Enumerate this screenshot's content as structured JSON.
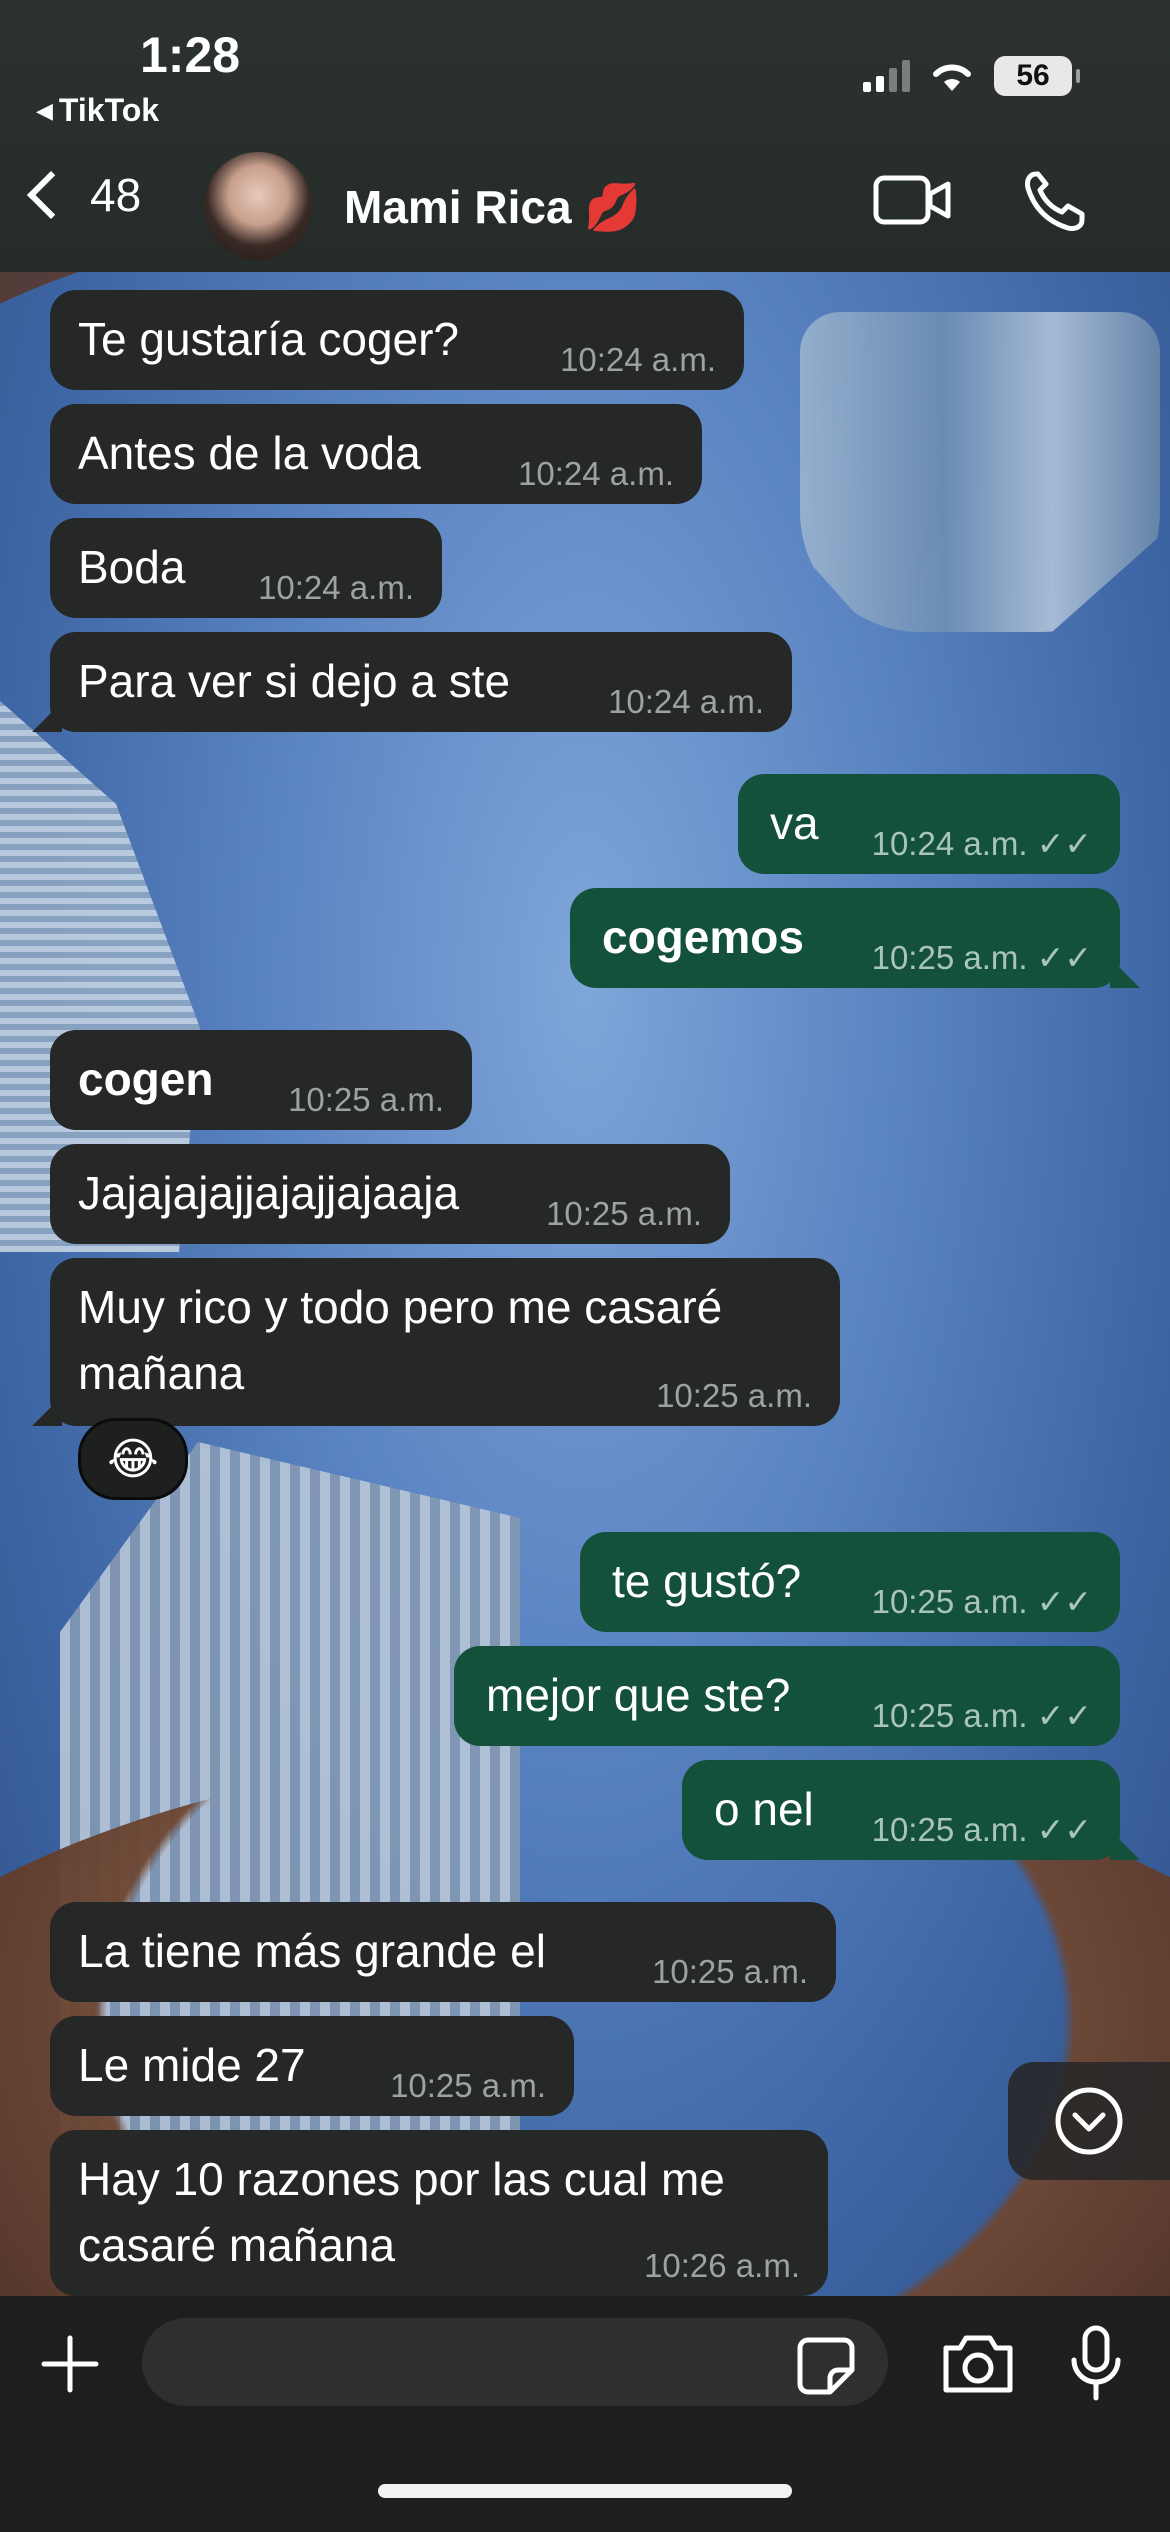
{
  "status_bar": {
    "time": "1:28",
    "back_app": "TikTok",
    "battery": "56",
    "icons": [
      "signal-icon",
      "wifi-icon",
      "battery-icon"
    ]
  },
  "header": {
    "back_count": "48",
    "contact_name": "Mami Rica 💋",
    "icons": [
      "back-chevron-icon",
      "video-call-icon",
      "phone-call-icon"
    ]
  },
  "messages": [
    {
      "dir": "in",
      "text": "Te gustaría coger?",
      "time": "10:24 a.m."
    },
    {
      "dir": "in",
      "text": "Antes de la voda",
      "time": "10:24 a.m."
    },
    {
      "dir": "in",
      "text": "Boda",
      "time": "10:24 a.m."
    },
    {
      "dir": "in",
      "text": "Para ver si dejo a ste",
      "time": "10:24 a.m."
    },
    {
      "dir": "out",
      "text": "va",
      "time": "10:24 a.m. ✓✓"
    },
    {
      "dir": "out",
      "text": "cogemos",
      "time": "10:25 a.m. ✓✓",
      "bold": true
    },
    {
      "dir": "in",
      "text": "cogen",
      "time": "10:25 a.m.",
      "bold": true
    },
    {
      "dir": "in",
      "text": "Jajajajajjajajjajaaja",
      "time": "10:25 a.m."
    },
    {
      "dir": "in",
      "text_line1": "Muy rico y todo pero me casaré",
      "text_line2": "mañana",
      "time": "10:25 a.m.",
      "reaction": "😂"
    },
    {
      "dir": "out",
      "text": "te gustó?",
      "time": "10:25 a.m. ✓✓"
    },
    {
      "dir": "out",
      "text": "mejor que ste?",
      "time": "10:25 a.m. ✓✓"
    },
    {
      "dir": "out",
      "text": "o nel",
      "time": "10:25 a.m. ✓✓"
    },
    {
      "dir": "in",
      "text": "La tiene más grande el",
      "time": "10:25 a.m."
    },
    {
      "dir": "in",
      "text": "Le mide 27",
      "time": "10:25 a.m."
    },
    {
      "dir": "in",
      "text_line1": "Hay 10 razones por las cual me",
      "text_line2": "casaré mañana",
      "time": "10:26 a.m."
    }
  ],
  "composer": {
    "placeholder": "",
    "icons": [
      "plus-icon",
      "sticker-icon",
      "camera-icon",
      "microphone-icon"
    ]
  },
  "scroll_down": {
    "icon": "chevron-down-circle-icon"
  }
}
